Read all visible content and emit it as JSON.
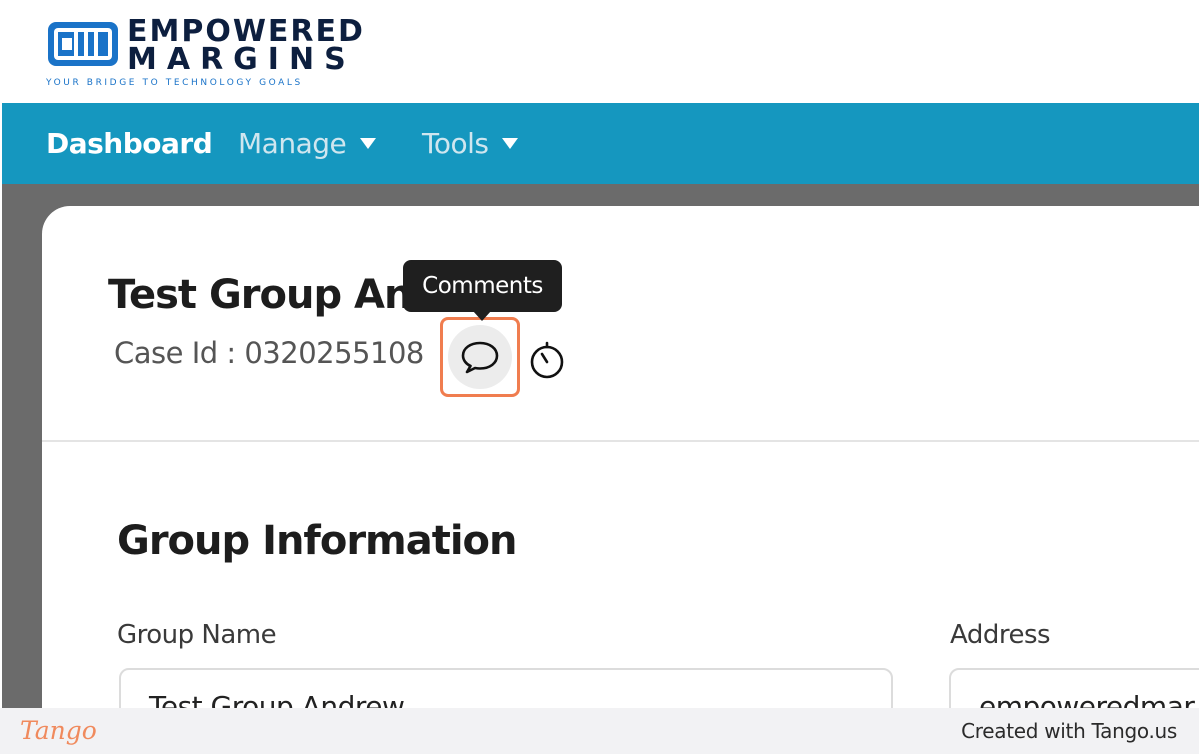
{
  "brand": {
    "line1": "EMPOWERED",
    "line2": "MARGINS",
    "tagline": "YOUR BRIDGE TO TECHNOLOGY GOALS",
    "logo_color": "#0d1f3f",
    "tagline_color": "#1a73c8"
  },
  "navbar": {
    "color": "#1597bf",
    "items": [
      {
        "label": "Dashboard",
        "active": true
      },
      {
        "label": "Manage",
        "dropdown": true
      },
      {
        "label": "Tools",
        "dropdown": true
      }
    ]
  },
  "case": {
    "title": "Test Group And",
    "case_id_text": "Case Id : 0320255108",
    "comments_tooltip": "Comments",
    "icons": [
      "comments-icon",
      "timer-icon"
    ],
    "highlight_color": "#f07d4f"
  },
  "group_info": {
    "section_title": "Group Information",
    "fields": [
      {
        "label": "Group Name",
        "value": "Test Group Andrew"
      },
      {
        "label": "Address",
        "value": "empoweredmar"
      }
    ]
  },
  "footer": {
    "tango_logo": "Tango",
    "created_with": "Created with Tango.us"
  }
}
